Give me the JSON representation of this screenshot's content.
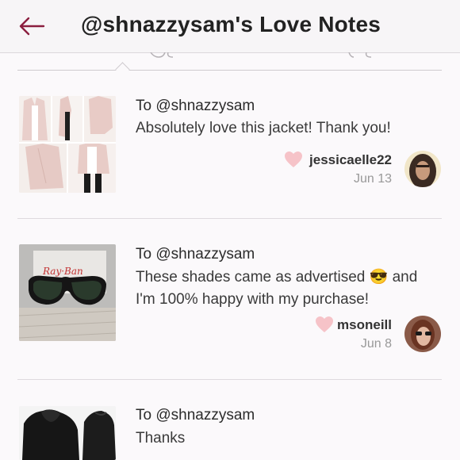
{
  "header": {
    "title": "@shnazzysam's Love Notes",
    "back_icon": "back-arrow-icon"
  },
  "colors": {
    "accent": "#8b1e3f",
    "heart": "#f6c3c8"
  },
  "notes": [
    {
      "to": "To @shnazzysam",
      "message": "Absolutely love this jacket! Thank you!",
      "sender": "jessicaelle22",
      "date": "Jun 13"
    },
    {
      "to": "To @shnazzysam",
      "message": "These shades came as advertised 😎 and I'm 100% happy with my purchase!",
      "sender": "msoneill",
      "date": "Jun 8"
    },
    {
      "to": "To @shnazzysam",
      "message": "Thanks",
      "sender": "",
      "date": ""
    }
  ]
}
